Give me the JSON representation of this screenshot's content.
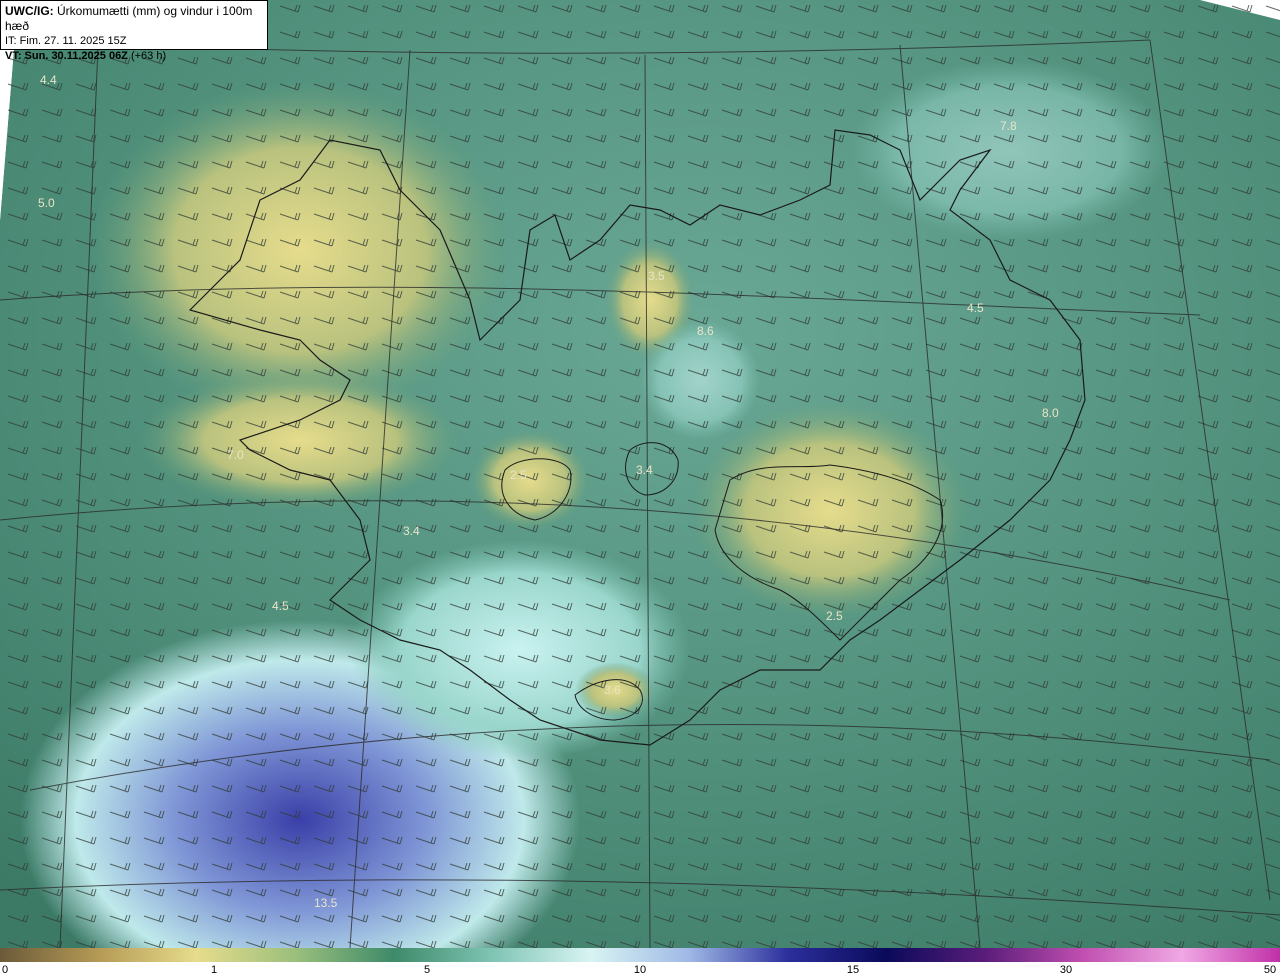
{
  "header": {
    "product": "UWC/IG:",
    "title": "Úrkomumætti (mm) og vindur i 100m hæð",
    "issue_time": "IT: Fim. 27. 11. 2025 15Z",
    "valid_prefix": "VT: Sun. 30.11.2025 06Z",
    "valid_suffix": "(+63 h)"
  },
  "map": {
    "region": "Iceland",
    "field": "precipitable water (mm)",
    "overlay": "wind barbs at 100m",
    "value_labels": [
      {
        "text": "4.4",
        "place": "northwest sea corner"
      },
      {
        "text": "5.0",
        "place": "west of Westfjords"
      },
      {
        "text": "7.8",
        "place": "northeast sea"
      },
      {
        "text": "3.5",
        "place": "north-central highlands"
      },
      {
        "text": "8.6",
        "place": "north-central valley"
      },
      {
        "text": "4.5",
        "place": "east Iceland"
      },
      {
        "text": "8.0",
        "place": "east coast"
      },
      {
        "text": "7.0",
        "place": "Snæfellsnes peninsula"
      },
      {
        "text": "2.5",
        "place": "Langjökull"
      },
      {
        "text": "3.4",
        "place": "Hofsjökull"
      },
      {
        "text": "3.4",
        "place": "Reykjanes area"
      },
      {
        "text": "4.5",
        "place": "southwest sea"
      },
      {
        "text": "2.5",
        "place": "south Vatnajökull"
      },
      {
        "text": "3.6",
        "place": "Mýrdalsjökull"
      },
      {
        "text": "13.5",
        "place": "southwest far sea"
      }
    ]
  },
  "colorbar": {
    "ticks": [
      "0",
      "1",
      "5",
      "10",
      "15",
      "30",
      "50"
    ],
    "colors": [
      "#6b5a3a",
      "#b59a55",
      "#e6dc8c",
      "#9bbf7c",
      "#3e8a6a",
      "#7fc4b4",
      "#d8f4f2",
      "#9fb8e6",
      "#2c2f9c",
      "#0a0a5a",
      "#5a1d7a",
      "#c04fb0",
      "#f0a8e4",
      "#c030a8"
    ]
  }
}
